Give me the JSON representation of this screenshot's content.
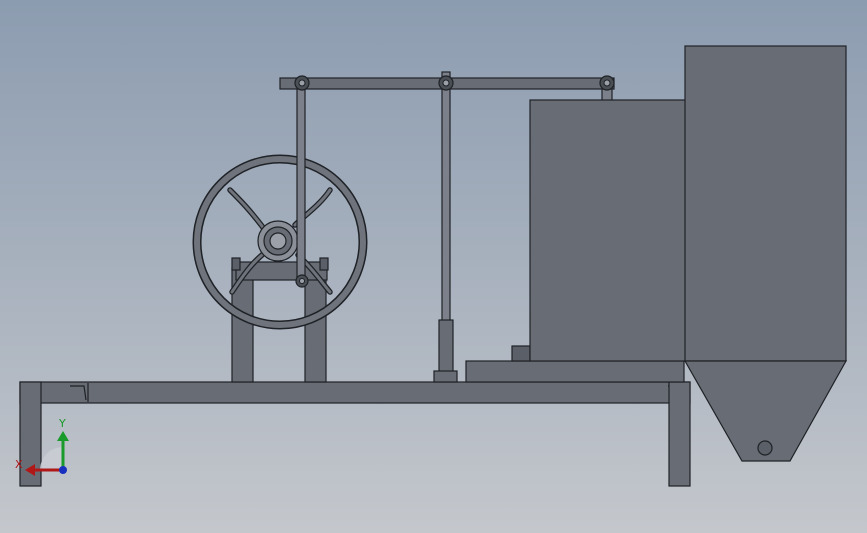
{
  "triad": {
    "x_label": "X",
    "y_label": "Y",
    "colors": {
      "x": "#b01818",
      "y": "#1a9a2a",
      "z": "#1830c0"
    }
  },
  "colors": {
    "part_fill": "#676c75",
    "edge": "#1f2226",
    "background_top": "#8c9cb0",
    "background_bottom": "#c4c7cc"
  }
}
